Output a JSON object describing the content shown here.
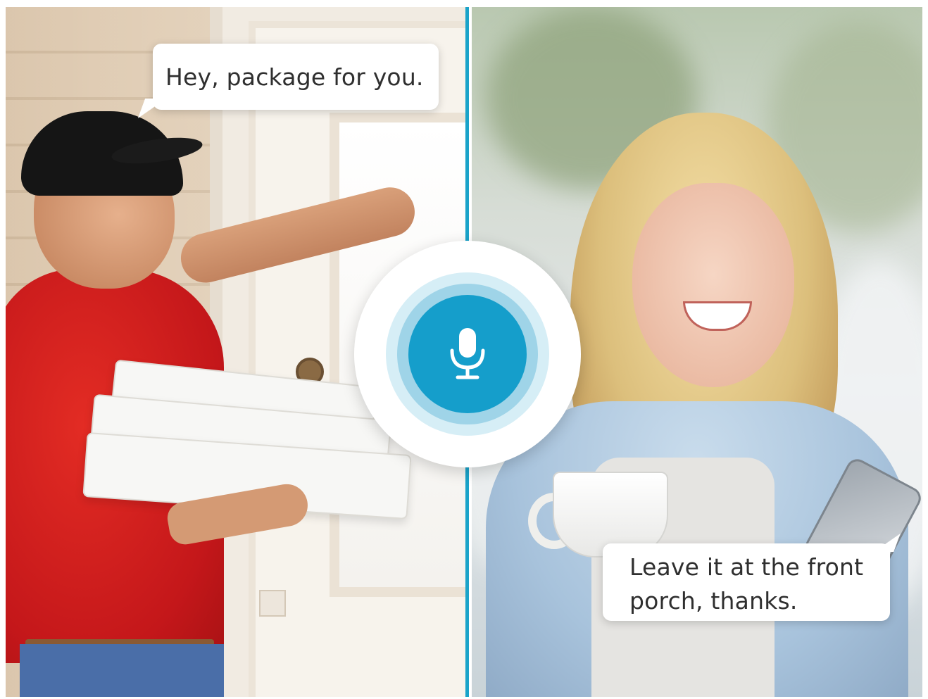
{
  "bubbles": {
    "courier_text": "Hey, package for you.",
    "resident_line1": "Leave it at the front",
    "resident_line2": "porch, thanks."
  },
  "badge": {
    "icon": "microphone-icon"
  },
  "colors": {
    "accent": "#159ecb",
    "divider": "#1aa3c9",
    "ring_light": "#d6eef6",
    "ring_mid": "#9fd4e8"
  }
}
